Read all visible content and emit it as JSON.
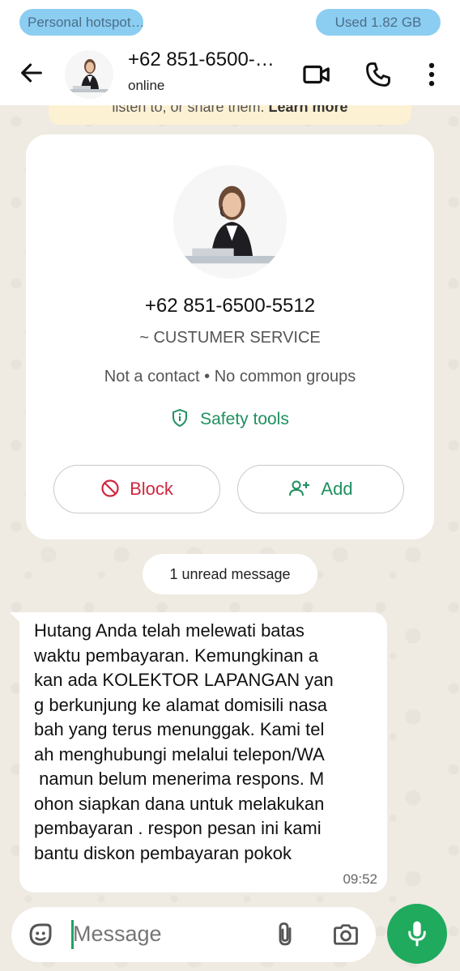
{
  "status_bar": {
    "hotspot_label": "Personal hotspot…",
    "data_usage": "Used  1.82 GB"
  },
  "header": {
    "title": "+62 851-6500-…",
    "status": "online",
    "icons": [
      "back-arrow-icon",
      "avatar",
      "video-call-icon",
      "voice-call-icon",
      "more-vert-icon"
    ]
  },
  "banner": {
    "text": "listen to, or share them.",
    "link": "Learn more"
  },
  "contact_card": {
    "phone": "+62 851-6500-5512",
    "name": "~ CUSTUMER SERVICE",
    "meta": "Not a contact • No common groups",
    "safety_tools": "Safety tools",
    "block_label": "Block",
    "add_label": "Add"
  },
  "unread": "1 unread message",
  "message": {
    "text": "Hutang Anda telah melewati batas\nwaktu pembayaran. Kemungkinan a\nkan ada KOLEKTOR LAPANGAN yan\ng berkunjung ke alamat domisili nasa\nbah yang terus menunggak. Kami tel\nah menghubungi melalui telepon/WA\n namun belum menerima respons. M\nohon siapkan dana untuk melakukan\npembayaran . respon pesan ini kami\nbantu diskon pembayaran pokok",
    "time": "09:52"
  },
  "composer": {
    "placeholder": "Message"
  },
  "colors": {
    "accent_green": "#1faa5d",
    "block_red": "#d0263e",
    "chat_bg": "#efeae2",
    "pill_blue": "#8ccdf2"
  }
}
